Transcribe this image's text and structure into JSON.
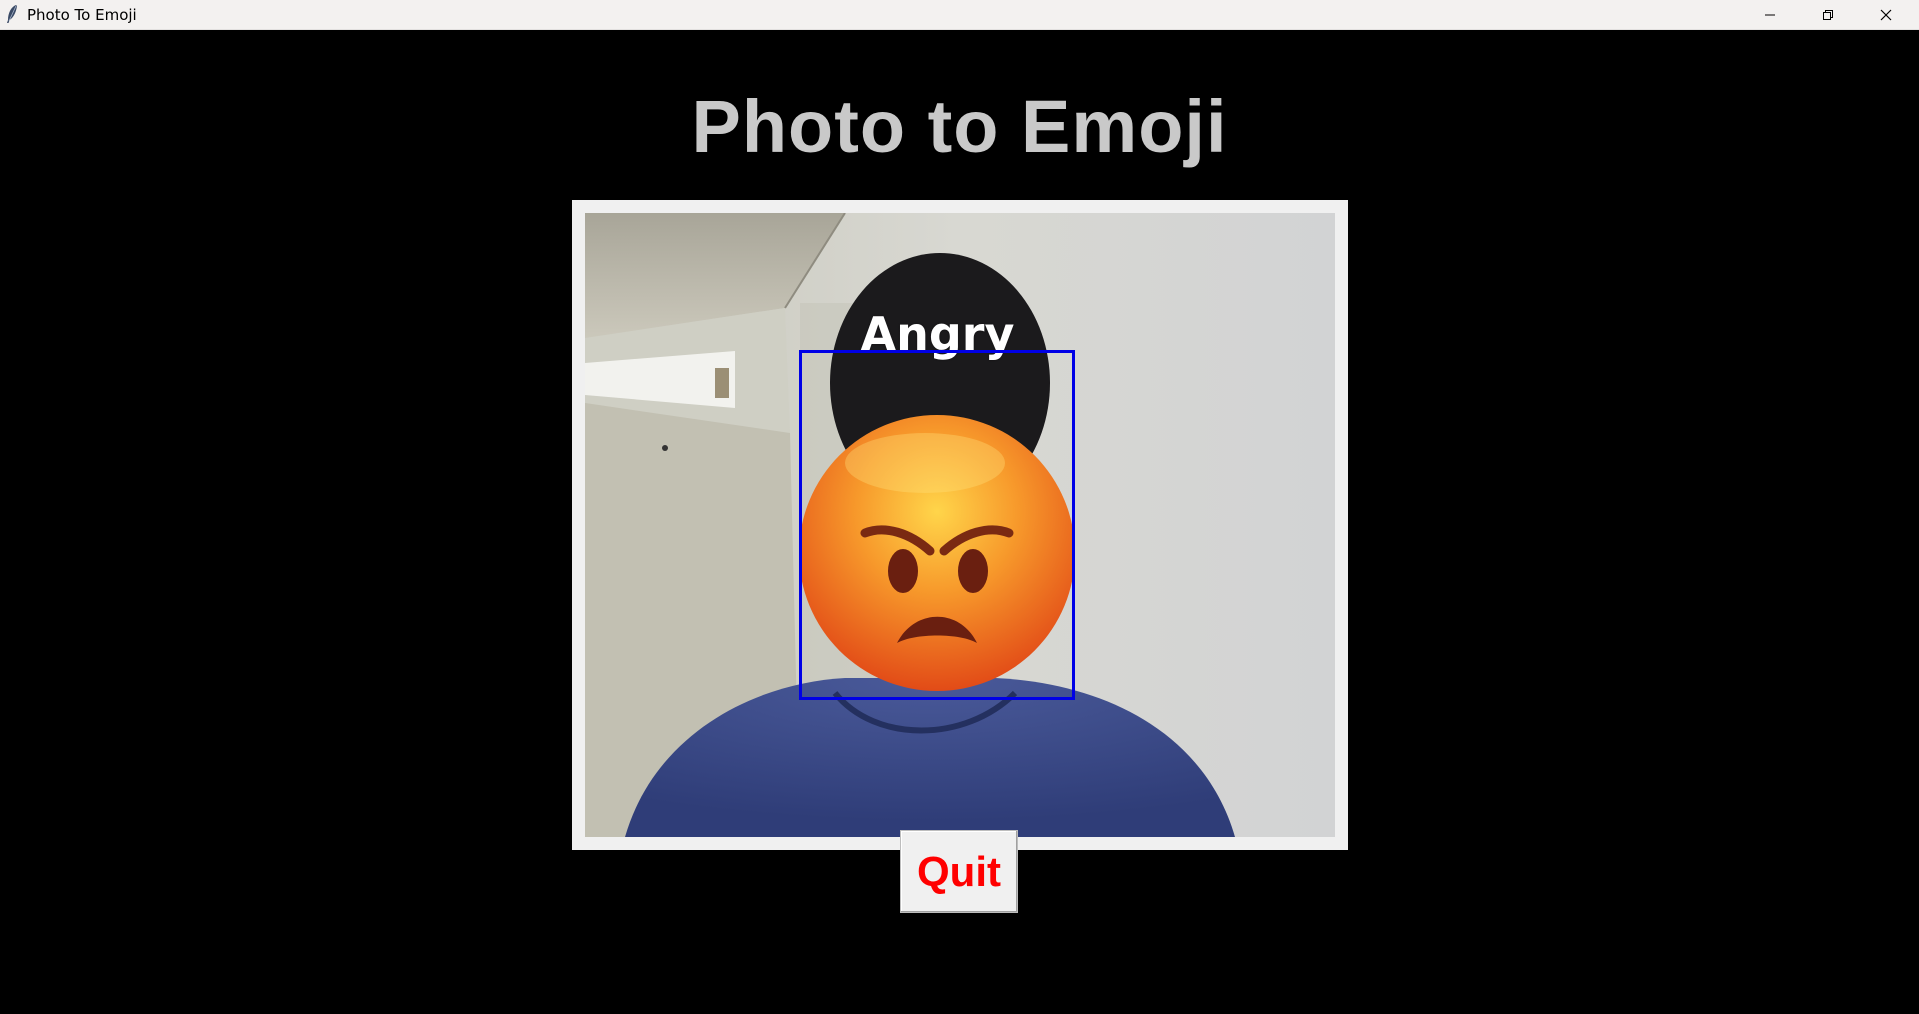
{
  "window": {
    "title": "Photo To Emoji",
    "icon": "feather-icon",
    "controls": [
      "minimize-icon",
      "restore-icon",
      "close-icon"
    ]
  },
  "heading": "Photo to Emoji",
  "video": {
    "emotion_label": "Angry",
    "emoji": "angry-face-emoji",
    "box_color": "#0000e6"
  },
  "quit_button": {
    "label": "Quit",
    "color": "#ff0000"
  }
}
